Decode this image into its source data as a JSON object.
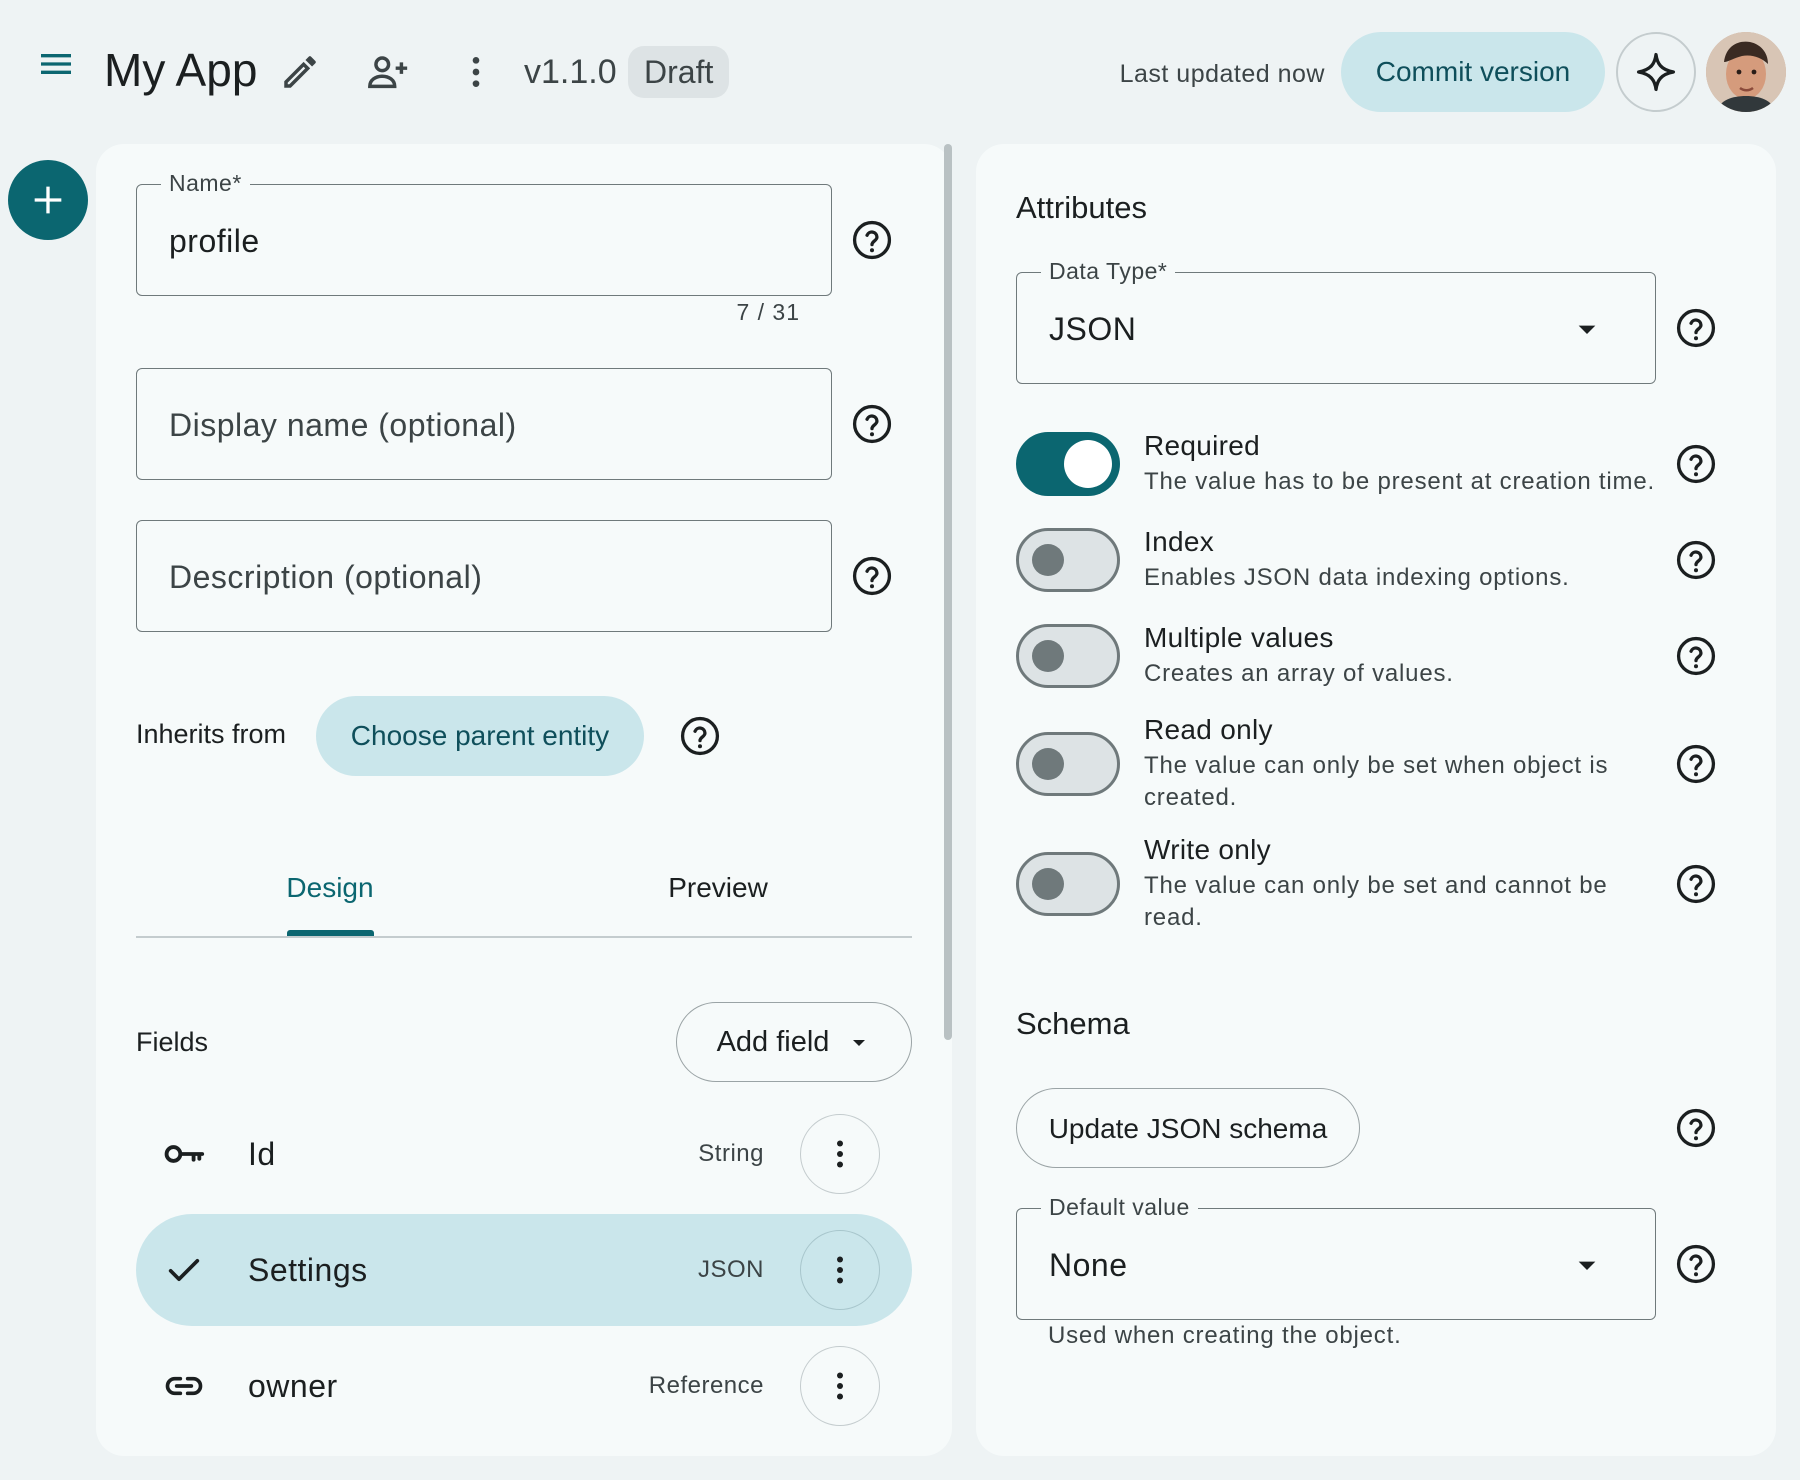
{
  "header": {
    "menu_icon": "menu-icon",
    "app_title": "My App",
    "edit_icon": "pencil-icon",
    "share_icon": "person-add-icon",
    "more_icon": "more-vert-icon",
    "version": "v1.1.0",
    "status_badge": "Draft",
    "last_updated": "Last updated now",
    "commit_label": "Commit version",
    "assistant_icon": "sparkle-icon",
    "avatar_icon": "user-avatar"
  },
  "fab": {
    "icon": "plus-icon"
  },
  "form": {
    "name": {
      "label": "Name*",
      "value": "profile",
      "counter": "7 / 31"
    },
    "display_name": {
      "placeholder": "Display name (optional)",
      "value": ""
    },
    "description": {
      "placeholder": "Description (optional)",
      "value": ""
    },
    "inherits": {
      "label": "Inherits from",
      "button": "Choose parent entity"
    }
  },
  "tabs": [
    {
      "label": "Design",
      "active": true
    },
    {
      "label": "Preview",
      "active": false
    }
  ],
  "fields_section": {
    "title": "Fields",
    "add_label": "Add field",
    "items": [
      {
        "name": "Id",
        "type": "String",
        "icon": "key-icon",
        "selected": false
      },
      {
        "name": "Settings",
        "type": "JSON",
        "icon": "check-icon",
        "selected": true
      },
      {
        "name": "owner",
        "type": "Reference",
        "icon": "link-icon",
        "selected": false
      }
    ]
  },
  "attributes": {
    "title": "Attributes",
    "data_type": {
      "label": "Data Type*",
      "value": "JSON"
    },
    "options": [
      {
        "title": "Required",
        "desc": "The value has to be present at creation time.",
        "on": true
      },
      {
        "title": "Index",
        "desc": "Enables JSON data indexing options.",
        "on": false
      },
      {
        "title": "Multiple values",
        "desc": "Creates an array of values.",
        "on": false
      },
      {
        "title": "Read only",
        "desc": "The value can only be set when object is created.",
        "on": false
      },
      {
        "title": "Write only",
        "desc": "The value can only be set and cannot be read.",
        "on": false
      }
    ]
  },
  "schema": {
    "title": "Schema",
    "update_label": "Update JSON schema",
    "default_value": {
      "label": "Default value",
      "value": "None",
      "supporting": "Used when creating the object."
    }
  },
  "colors": {
    "primary": "#0b6670",
    "tonal_container": "#cae6eb",
    "on_tonal": "#0f4f5b",
    "surface": "#f6fafa",
    "background": "#eef3f4"
  }
}
